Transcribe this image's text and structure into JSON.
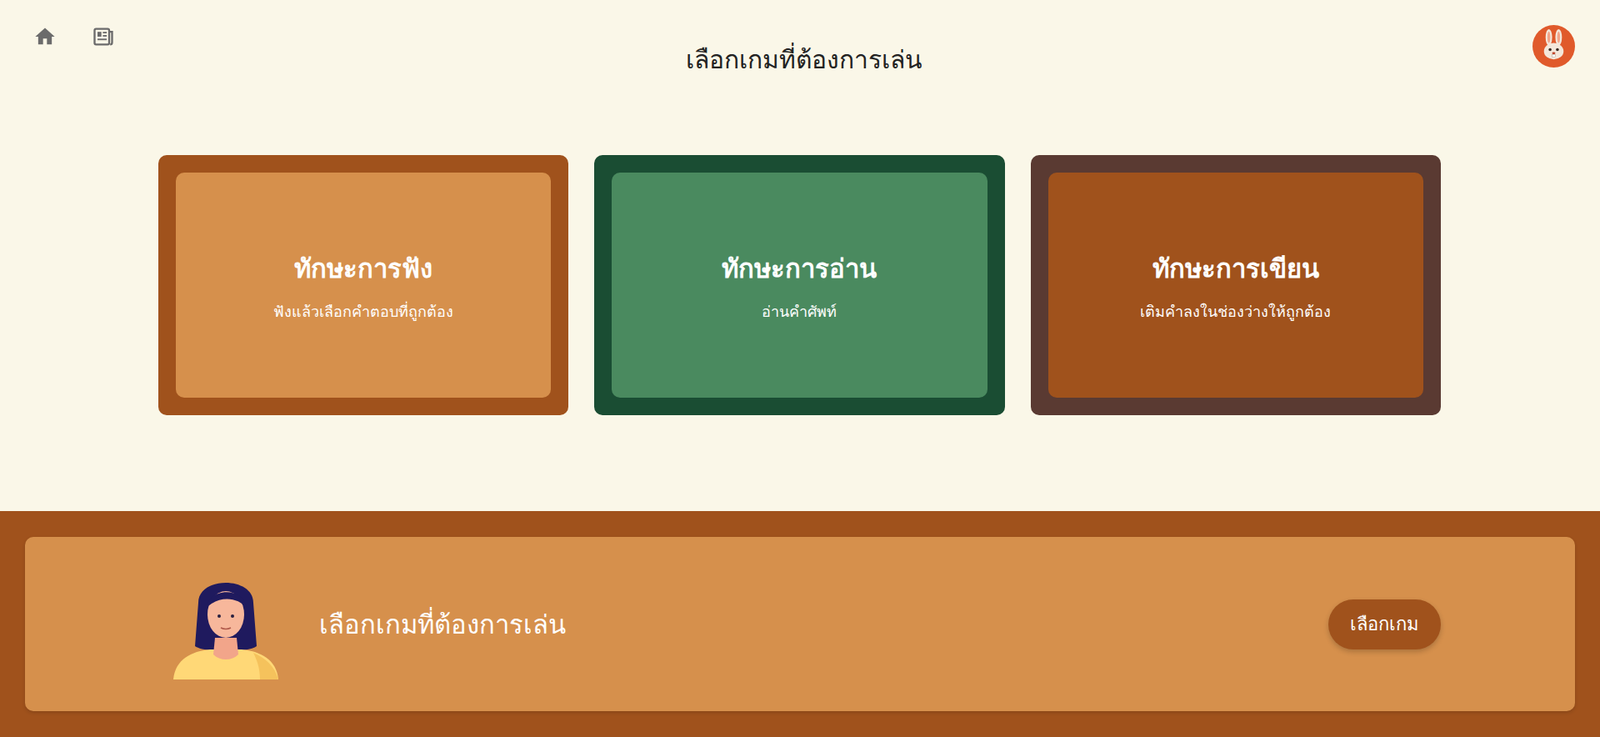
{
  "header": {
    "title": "เลือกเกมที่ต้องการเล่น"
  },
  "cards": [
    {
      "title": "ทักษะการฟัง",
      "subtitle": "ฟังแล้วเลือกคำตอบที่ถูกต้อง",
      "color": "#d6904c",
      "border_color": "#a0521c"
    },
    {
      "title": "ทักษะการอ่าน",
      "subtitle": "อ่านคำศัพท์",
      "color": "#4a8a5f",
      "border_color": "#1a4d33"
    },
    {
      "title": "ทักษะการเขียน",
      "subtitle": "เติมคำลงในช่องว่างให้ถูกต้อง",
      "color": "#a0521c",
      "border_color": "#5a3a32"
    }
  ],
  "banner": {
    "message": "เลือกเกมที่ต้องการเล่น",
    "button": "เลือกเกม"
  }
}
